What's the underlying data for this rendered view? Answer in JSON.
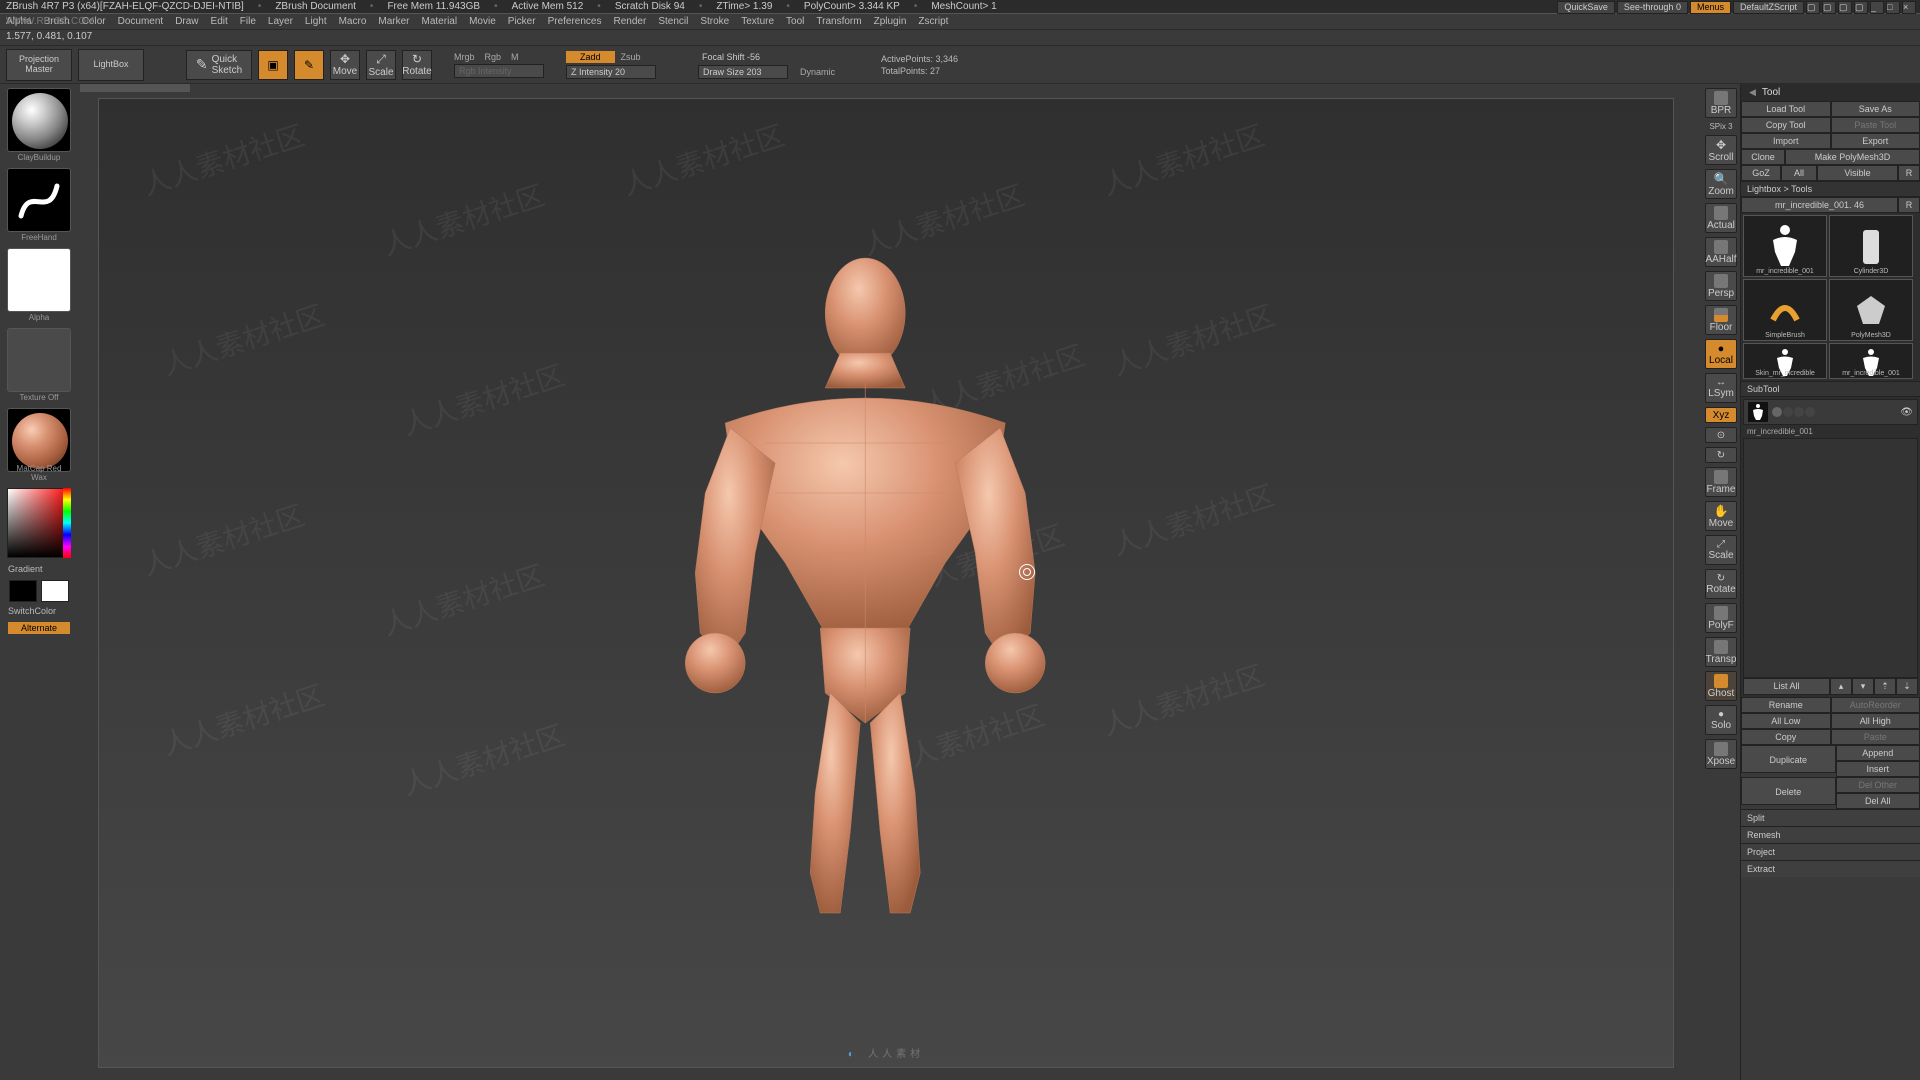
{
  "title": {
    "app": "ZBrush 4R7 P3 (x64)[FZAH-ELQF-QZCD-DJEI-NTIB]",
    "doc": "ZBrush Document",
    "freemem": "Free Mem 11.943GB",
    "activemem": "Active Mem 512",
    "scratch": "Scratch Disk 94",
    "ztime": "ZTime> 1.39",
    "polycount": "PolyCount> 3.344 KP",
    "meshcount": "MeshCount> 1",
    "site": "WWW.RR-SC.COM"
  },
  "menubar": [
    "Alpha",
    "Brush",
    "Color",
    "Document",
    "Draw",
    "Edit",
    "File",
    "Layer",
    "Light",
    "Macro",
    "Marker",
    "Material",
    "Movie",
    "Picker",
    "Preferences",
    "Render",
    "Stencil",
    "Stroke",
    "Texture",
    "Tool",
    "Transform",
    "Zplugin",
    "Zscript"
  ],
  "coord": "1.577, 0.481, 0.107",
  "shelf": {
    "projection": "Projection\nMaster",
    "lightbox": "LightBox",
    "quicksketch": "Quick\nSketch",
    "edit": "Edit",
    "draw": "Draw",
    "move": "Move",
    "scale": "Scale",
    "rotate": "Rotate",
    "mrgb": "Mrgb",
    "rgb": "Rgb",
    "m": "M",
    "rgbint": "Rgb Intensity",
    "zadd": "Zadd",
    "zsub": "Zsub",
    "zint": "Z Intensity 20",
    "focal": "Focal Shift -56",
    "drawsize": "Draw Size 203",
    "dynamic": "Dynamic",
    "activepoints": "ActivePoints: 3,346",
    "totalpoints": "TotalPoints: 27"
  },
  "topright": {
    "quicksave": "QuickSave",
    "seethrough": "See-through  0",
    "menus": "Menus",
    "defaultzscript": "DefaultZScript"
  },
  "left": {
    "brush": "ClayBuildup",
    "stroke": "FreeHand",
    "alpha": "Alpha",
    "texture": "Texture Off",
    "material": "MatCap Red Wax",
    "gradient": "Gradient",
    "switch": "SwitchColor",
    "alternate": "Alternate"
  },
  "rail": {
    "bpr": "BPR",
    "spix": "SPix 3",
    "scroll": "Scroll",
    "zoom": "Zoom",
    "actual": "Actual",
    "aahalf": "AAHalf",
    "persp": "Persp",
    "floor": "Floor",
    "local": "Local",
    "lsym": "LSym",
    "xyz": "Xyz",
    "frame": "Frame",
    "move": "Move",
    "scale": "Scale",
    "rotate": "Rotate",
    "polyf": "PolyF",
    "transp": "Transp",
    "ghost": "Ghost",
    "solo": "Solo",
    "xpose": "Xpose"
  },
  "tool": {
    "header": "Tool",
    "loadtool": "Load Tool",
    "saveas": "Save As",
    "copytool": "Copy Tool",
    "pastetool": "Paste Tool",
    "import": "Import",
    "export": "Export",
    "clone": "Clone",
    "makepm3d": "Make PolyMesh3D",
    "goz": "GoZ",
    "all": "All",
    "visible": "Visible",
    "r": "R",
    "lightboxtools": "Lightbox > Tools",
    "current": "mr_incredible_001. 46",
    "thumbs": [
      "mr_incredible_001",
      "Cylinder3D",
      "SimpleBrush",
      "PolyMesh3D",
      "Skin_mr_incredible",
      "mr_incredible_001"
    ],
    "subtool": "SubTool",
    "strow": "mr_incredible_001",
    "listall": "List All",
    "rename": "Rename",
    "autoreorder": "AutoReorder",
    "alllow": "All Low",
    "allhigh": "All High",
    "copy": "Copy",
    "paste": "Paste",
    "duplicate": "Duplicate",
    "append": "Append",
    "insert": "Insert",
    "delete": "Delete",
    "delother": "Del Other",
    "delall": "Del All",
    "split": "Split",
    "remesh": "Remesh",
    "project": "Project",
    "extract": "Extract"
  },
  "watermark": "人人素材社区",
  "bottomlogo": "人人素材"
}
